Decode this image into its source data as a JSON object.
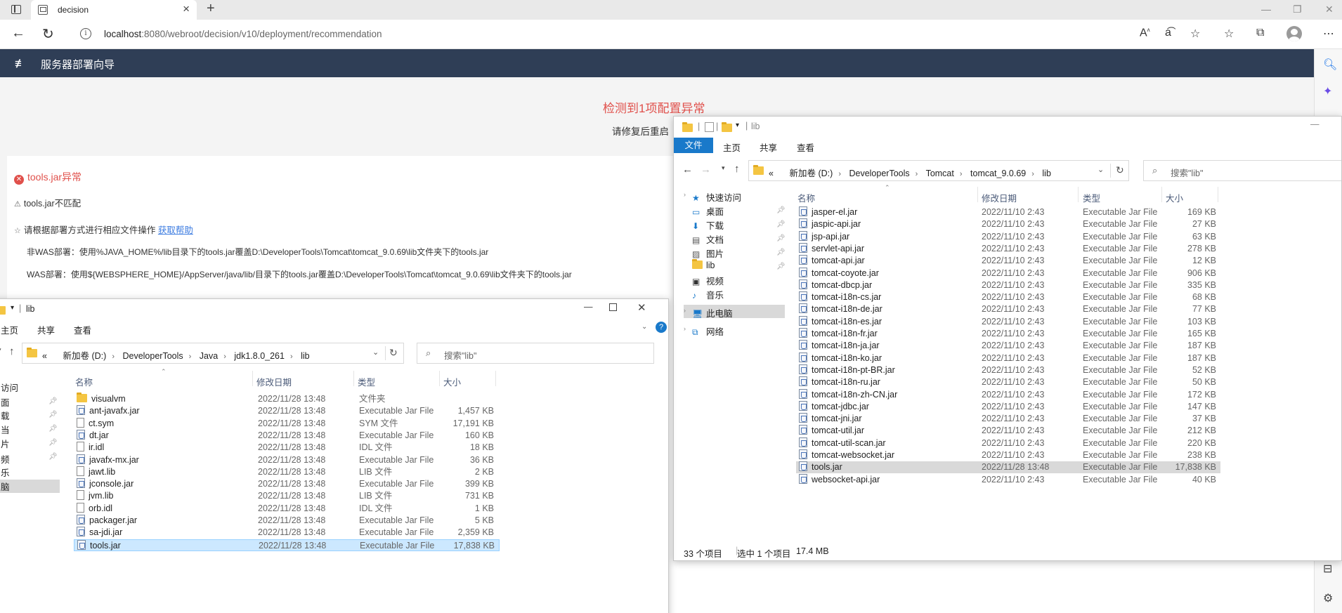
{
  "browser": {
    "tab_title": "decision",
    "url_host": "localhost",
    "url_rest": ":8080/webroot/decision/v10/deployment/recommendation"
  },
  "app": {
    "header_title": "服务器部署向导",
    "alert_title": "检测到1项配置异常",
    "alert_sub": "请修复后重启",
    "error_title": "tools.jar异常",
    "mismatch": "tools.jar不匹配",
    "instruction": "请根据部署方式进行相应文件操作",
    "help_link": "获取帮助",
    "non_was": "非WAS部署：使用%JAVA_HOME%/lib目录下的tools.jar覆盖D:\\DeveloperTools\\Tomcat\\tomcat_9.0.69\\lib文件夹下的tools.jar",
    "was": "WAS部署：使用${WEBSPHERE_HOME}/AppServer/java/lib/目录下的tools.jar覆盖D:\\DeveloperTools\\Tomcat\\tomcat_9.0.69\\lib文件夹下的tools.jar"
  },
  "explorer_left": {
    "title": "lib",
    "ribbon": [
      "主页",
      "共享",
      "查看"
    ],
    "breadcrumb": [
      "«",
      "新加卷 (D:)",
      "DeveloperTools",
      "Java",
      "jdk1.8.0_261",
      "lib"
    ],
    "search_placeholder": "搜索\"lib\"",
    "columns": [
      "名称",
      "修改日期",
      "类型",
      "大小"
    ],
    "nav": [
      "访问",
      "面",
      "载",
      "当",
      "片",
      "频",
      "乐",
      "脑"
    ],
    "files": [
      {
        "name": "visualvm",
        "date": "2022/11/28 13:48",
        "type": "文件夹",
        "size": "",
        "icon": "folder"
      },
      {
        "name": "ant-javafx.jar",
        "date": "2022/11/28 13:48",
        "type": "Executable Jar File",
        "size": "1,457 KB",
        "icon": "jar"
      },
      {
        "name": "ct.sym",
        "date": "2022/11/28 13:48",
        "type": "SYM 文件",
        "size": "17,191 KB",
        "icon": "file"
      },
      {
        "name": "dt.jar",
        "date": "2022/11/28 13:48",
        "type": "Executable Jar File",
        "size": "160 KB",
        "icon": "jar"
      },
      {
        "name": "ir.idl",
        "date": "2022/11/28 13:48",
        "type": "IDL 文件",
        "size": "18 KB",
        "icon": "file"
      },
      {
        "name": "javafx-mx.jar",
        "date": "2022/11/28 13:48",
        "type": "Executable Jar File",
        "size": "36 KB",
        "icon": "jar"
      },
      {
        "name": "jawt.lib",
        "date": "2022/11/28 13:48",
        "type": "LIB 文件",
        "size": "2 KB",
        "icon": "file"
      },
      {
        "name": "jconsole.jar",
        "date": "2022/11/28 13:48",
        "type": "Executable Jar File",
        "size": "399 KB",
        "icon": "jar"
      },
      {
        "name": "jvm.lib",
        "date": "2022/11/28 13:48",
        "type": "LIB 文件",
        "size": "731 KB",
        "icon": "file"
      },
      {
        "name": "orb.idl",
        "date": "2022/11/28 13:48",
        "type": "IDL 文件",
        "size": "1 KB",
        "icon": "file"
      },
      {
        "name": "packager.jar",
        "date": "2022/11/28 13:48",
        "type": "Executable Jar File",
        "size": "5 KB",
        "icon": "jar"
      },
      {
        "name": "sa-jdi.jar",
        "date": "2022/11/28 13:48",
        "type": "Executable Jar File",
        "size": "2,359 KB",
        "icon": "jar"
      },
      {
        "name": "tools.jar",
        "date": "2022/11/28 13:48",
        "type": "Executable Jar File",
        "size": "17,838 KB",
        "icon": "jar",
        "selected": true
      }
    ]
  },
  "explorer_right": {
    "title": "lib",
    "ribbon": [
      "文件",
      "主页",
      "共享",
      "查看"
    ],
    "breadcrumb": [
      "«",
      "新加卷 (D:)",
      "DeveloperTools",
      "Tomcat",
      "tomcat_9.0.69",
      "lib"
    ],
    "search_placeholder": "搜索\"lib\"",
    "columns": [
      "名称",
      "修改日期",
      "类型",
      "大小"
    ],
    "nav": [
      {
        "label": "快速访问",
        "kind": "star"
      },
      {
        "label": "桌面",
        "kind": "desk",
        "pin": true
      },
      {
        "label": "下载",
        "kind": "down",
        "pin": true
      },
      {
        "label": "文档",
        "kind": "doc",
        "pin": true
      },
      {
        "label": "图片",
        "kind": "pic",
        "pin": true
      },
      {
        "label": "lib",
        "kind": "folder",
        "pin": true
      },
      {
        "label": "视频",
        "kind": "video"
      },
      {
        "label": "音乐",
        "kind": "music"
      },
      {
        "label": "此电脑",
        "kind": "pc"
      },
      {
        "label": "网络",
        "kind": "net"
      }
    ],
    "status": {
      "count": "33 个项目",
      "selected": "选中 1 个项目",
      "size": "17.4 MB"
    },
    "files": [
      {
        "name": "jasper-el.jar",
        "date": "2022/11/10 2:43",
        "type": "Executable Jar File",
        "size": "169 KB"
      },
      {
        "name": "jaspic-api.jar",
        "date": "2022/11/10 2:43",
        "type": "Executable Jar File",
        "size": "27 KB"
      },
      {
        "name": "jsp-api.jar",
        "date": "2022/11/10 2:43",
        "type": "Executable Jar File",
        "size": "63 KB"
      },
      {
        "name": "servlet-api.jar",
        "date": "2022/11/10 2:43",
        "type": "Executable Jar File",
        "size": "278 KB"
      },
      {
        "name": "tomcat-api.jar",
        "date": "2022/11/10 2:43",
        "type": "Executable Jar File",
        "size": "12 KB"
      },
      {
        "name": "tomcat-coyote.jar",
        "date": "2022/11/10 2:43",
        "type": "Executable Jar File",
        "size": "906 KB"
      },
      {
        "name": "tomcat-dbcp.jar",
        "date": "2022/11/10 2:43",
        "type": "Executable Jar File",
        "size": "335 KB"
      },
      {
        "name": "tomcat-i18n-cs.jar",
        "date": "2022/11/10 2:43",
        "type": "Executable Jar File",
        "size": "68 KB"
      },
      {
        "name": "tomcat-i18n-de.jar",
        "date": "2022/11/10 2:43",
        "type": "Executable Jar File",
        "size": "77 KB"
      },
      {
        "name": "tomcat-i18n-es.jar",
        "date": "2022/11/10 2:43",
        "type": "Executable Jar File",
        "size": "103 KB"
      },
      {
        "name": "tomcat-i18n-fr.jar",
        "date": "2022/11/10 2:43",
        "type": "Executable Jar File",
        "size": "165 KB"
      },
      {
        "name": "tomcat-i18n-ja.jar",
        "date": "2022/11/10 2:43",
        "type": "Executable Jar File",
        "size": "187 KB"
      },
      {
        "name": "tomcat-i18n-ko.jar",
        "date": "2022/11/10 2:43",
        "type": "Executable Jar File",
        "size": "187 KB"
      },
      {
        "name": "tomcat-i18n-pt-BR.jar",
        "date": "2022/11/10 2:43",
        "type": "Executable Jar File",
        "size": "52 KB"
      },
      {
        "name": "tomcat-i18n-ru.jar",
        "date": "2022/11/10 2:43",
        "type": "Executable Jar File",
        "size": "50 KB"
      },
      {
        "name": "tomcat-i18n-zh-CN.jar",
        "date": "2022/11/10 2:43",
        "type": "Executable Jar File",
        "size": "172 KB"
      },
      {
        "name": "tomcat-jdbc.jar",
        "date": "2022/11/10 2:43",
        "type": "Executable Jar File",
        "size": "147 KB"
      },
      {
        "name": "tomcat-jni.jar",
        "date": "2022/11/10 2:43",
        "type": "Executable Jar File",
        "size": "37 KB"
      },
      {
        "name": "tomcat-util.jar",
        "date": "2022/11/10 2:43",
        "type": "Executable Jar File",
        "size": "212 KB"
      },
      {
        "name": "tomcat-util-scan.jar",
        "date": "2022/11/10 2:43",
        "type": "Executable Jar File",
        "size": "220 KB"
      },
      {
        "name": "tomcat-websocket.jar",
        "date": "2022/11/10 2:43",
        "type": "Executable Jar File",
        "size": "238 KB"
      },
      {
        "name": "tools.jar",
        "date": "2022/11/28 13:48",
        "type": "Executable Jar File",
        "size": "17,838 KB",
        "selected": true
      },
      {
        "name": "websocket-api.jar",
        "date": "2022/11/10 2:43",
        "type": "Executable Jar File",
        "size": "40 KB"
      }
    ]
  }
}
